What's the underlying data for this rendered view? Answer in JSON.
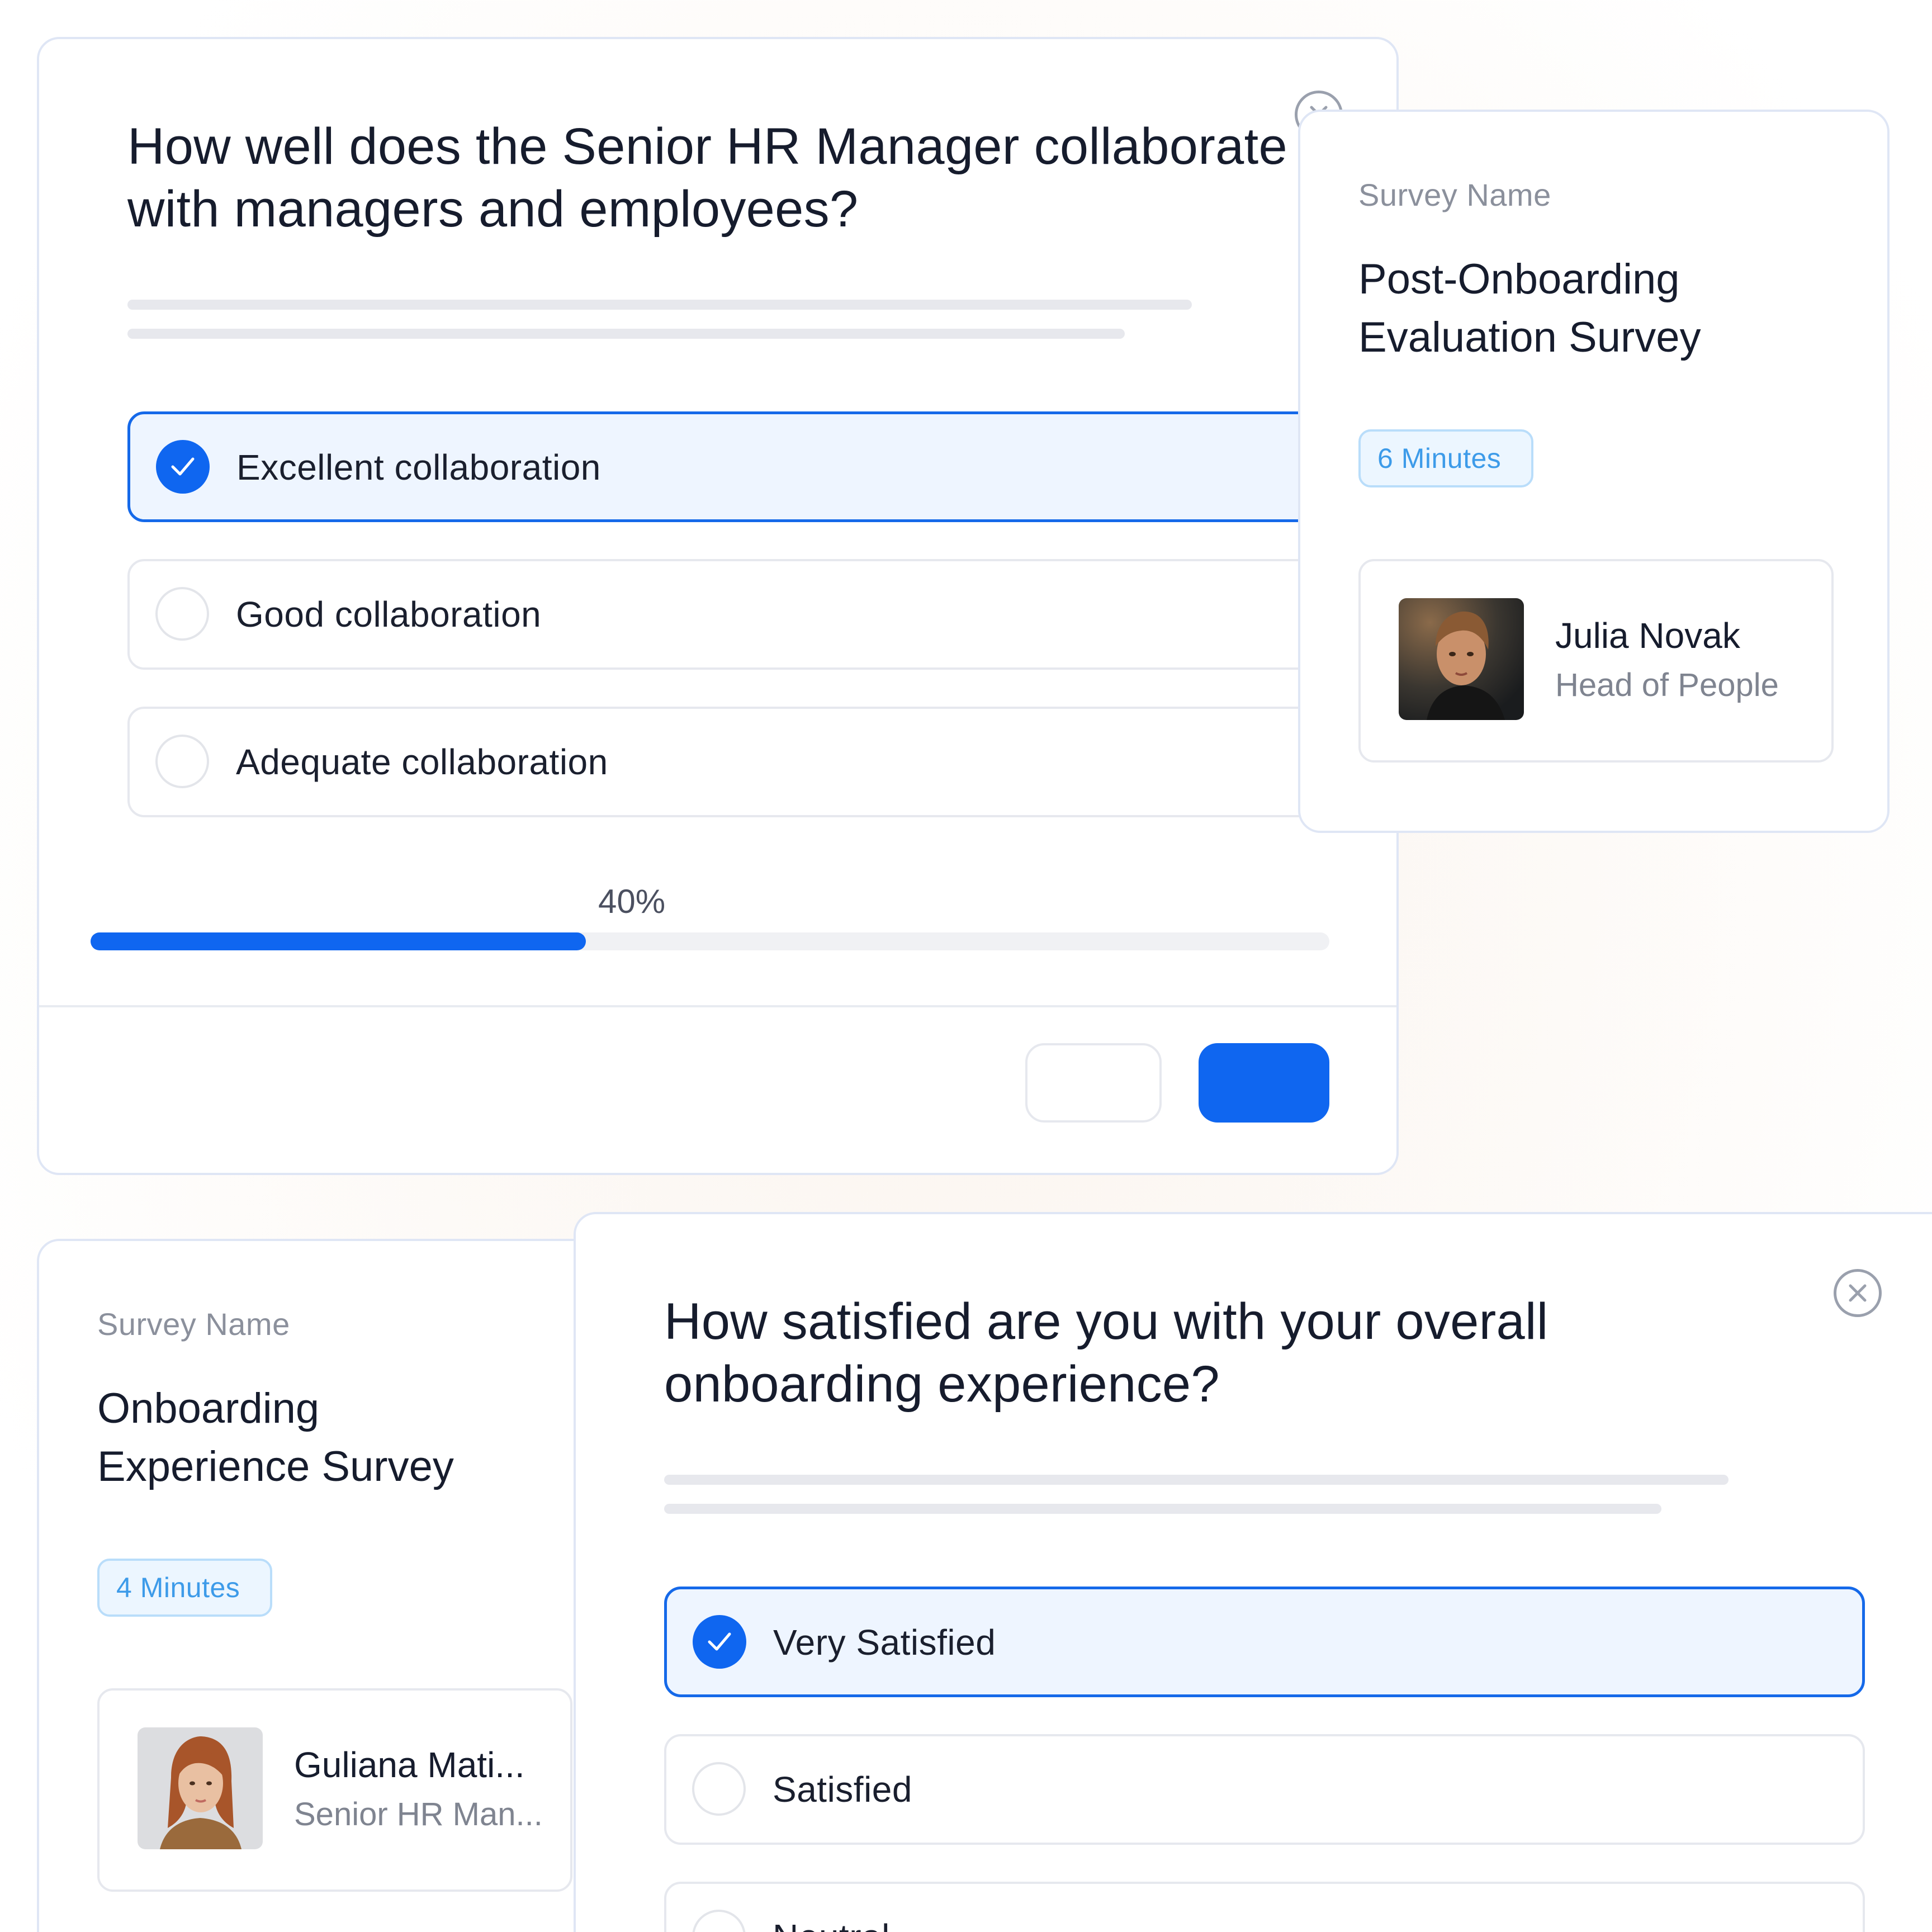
{
  "survey_question_card": {
    "question": "How well does the Senior HR Manager collaborate with managers and employees?",
    "options": [
      {
        "label": "Excellent collaboration",
        "selected": true
      },
      {
        "label": "Good collaboration",
        "selected": false
      },
      {
        "label": "Adequate collaboration",
        "selected": false
      }
    ],
    "progress_label": "40%",
    "progress_value": 0.4,
    "back_button_label": "",
    "next_button_label": ""
  },
  "post_onboarding_card": {
    "label": "Survey Name",
    "title": "Post-Onboarding Evaluation Survey",
    "duration": "6 Minutes",
    "owner_name": "Julia Novak",
    "owner_role": "Head of People"
  },
  "onboarding_card": {
    "label": "Survey Name",
    "title": "Onboarding Experience Survey",
    "duration": "4 Minutes",
    "owner_name": "Guliana Mati...",
    "owner_role": "Senior HR Man..."
  },
  "satisfaction_card": {
    "question": "How satisfied are you with your overall onboarding experience?",
    "options": [
      {
        "label": "Very Satisfied",
        "selected": true
      },
      {
        "label": "Satisfied",
        "selected": false
      },
      {
        "label": "Neutral",
        "selected": false
      }
    ]
  },
  "colors": {
    "accent": "#0f66f0",
    "selected_bg": "#eef5ff",
    "badge_text": "#3d9be9",
    "badge_bg": "#ecf6ff",
    "card_border": "#dfe6f5"
  },
  "icons": [
    "check-icon",
    "close-icon"
  ]
}
